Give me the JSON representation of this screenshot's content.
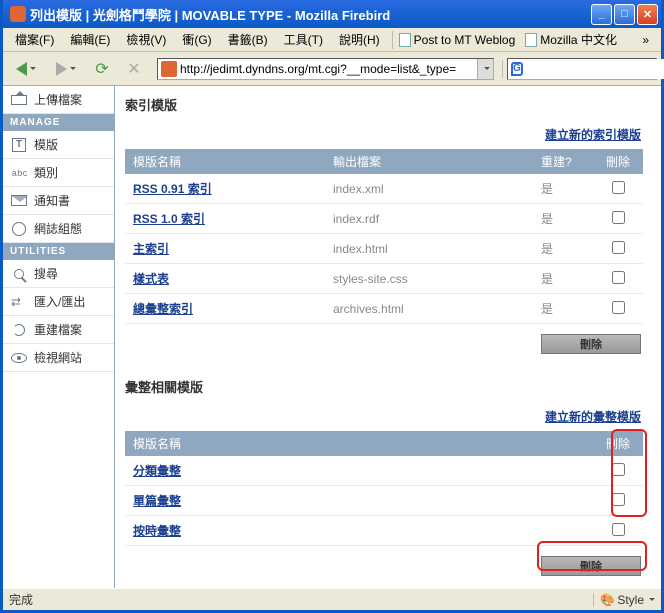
{
  "window": {
    "title": "列出模版 | 光劍格鬥學院 | MOVABLE TYPE - Mozilla Firebird"
  },
  "menu": {
    "file": "檔案(F)",
    "edit": "編輯(E)",
    "view": "檢視(V)",
    "go": "衝(G)",
    "bookmarks": "書籤(B)",
    "tools": "工具(T)",
    "help": "說明(H)",
    "bk1": "Post to MT Weblog",
    "bk2": "Mozilla 中文化"
  },
  "url": "http://jedimt.dyndns.org/mt.cgi?__mode=list&_type=",
  "search_letter": "G",
  "sidebar": {
    "upload": "上傳檔案",
    "head_manage": "MANAGE",
    "templates": "模版",
    "categories": "類別",
    "notify": "通知書",
    "weblog_cfg": "網誌組態",
    "head_utils": "UTILITIES",
    "search": "搜尋",
    "import": "匯入/匯出",
    "rebuild": "重建檔案",
    "viewsite": "檢視網站"
  },
  "section1": {
    "title": "索引模版",
    "newlink": "建立新的索引模版",
    "th_name": "模版名稱",
    "th_out": "輸出檔案",
    "th_rebuild": "重建?",
    "th_del": "刪除",
    "rows": [
      {
        "name": "RSS 0.91 索引",
        "out": "index.xml",
        "rb": "是"
      },
      {
        "name": "RSS 1.0 索引",
        "out": "index.rdf",
        "rb": "是"
      },
      {
        "name": "主索引",
        "out": "index.html",
        "rb": "是"
      },
      {
        "name": "樣式表",
        "out": "styles-site.css",
        "rb": "是"
      },
      {
        "name": "總彙整索引",
        "out": "archives.html",
        "rb": "是"
      }
    ],
    "delbtn": "刪除"
  },
  "section2": {
    "title": "彙整相關模版",
    "newlink": "建立新的彙整模版",
    "th_name": "模版名稱",
    "th_del": "刪除",
    "rows": [
      {
        "name": "分類彙整"
      },
      {
        "name": "單篇彙整"
      },
      {
        "name": "按時彙整"
      }
    ],
    "delbtn": "刪除"
  },
  "status": {
    "left": "完成",
    "style": "Style"
  }
}
